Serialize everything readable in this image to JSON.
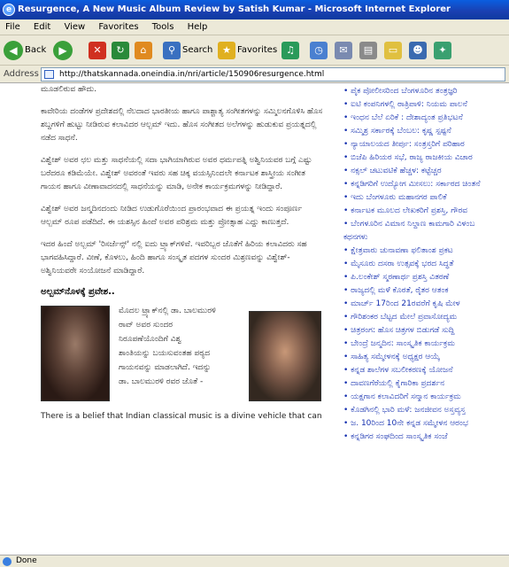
{
  "window": {
    "title": "Resurgence, A New Music Album Review by Satish Kumar - Microsoft Internet Explorer"
  },
  "menu": [
    "File",
    "Edit",
    "View",
    "Favorites",
    "Tools",
    "Help"
  ],
  "toolbar": {
    "back": "Back",
    "search": "Search",
    "favorites": "Favorites"
  },
  "address": {
    "label": "Address",
    "url": "http://thatskannada.oneindia.in/nri/article/150906resurgence.html"
  },
  "article": {
    "paragraphs": [
      "ಮೂಡಲಿರುವ ಹೌದು.",
      "ಕಾವೇರಿಯ ದಂಡೆಗಳ ಪ್ರದೇಶದಲ್ಲಿ ನೆಲದಾದ ಭಾರತೀಯ ಹಾಗೂ ಪಾಶ್ಚಾತ್ಯ ಸಂಗೀತಗಳನ್ನು ಸಮ್ಮಿಲನಗೊಳಿಸಿ ಹೊಸ ಶಬ್ದಗಳಿಗೆ ಹುಟ್ಟು ನೀಡಿರುವ ಕಲಾವಿದರ ಆಲ್ಬಮ್ ಇದು. ಹೊಸ ಸಂಗೀತದ ಅಲೆಗಳನ್ನು ಹುಡುಕುವ ಪ್ರಯತ್ನದಲ್ಲಿ ನಡೆದ ಸಾಧನೆ.",
      "ವಿಶ್ವೇಶ್ ಅವರ ಛಲ ಮತ್ತು ಸಾಧನೆಯಲ್ಲಿ ಸದಾ ಭಾಗಿಯಾಗಿರುವ ಅವರ ಧರ್ಮಪತ್ನಿ ಅಶ್ವಿನಿಯವರ ಬಗ್ಗೆ ಎಷ್ಟು ಬರೆದರೂ ಕಡಿಮೆಯೇ. ವಿಶ್ವೇಶ್ ಅವರಂತೆ ಇವರು ಸಹ ಚಿಕ್ಕ ವಯಸ್ಸಿನಿಂದಲೇ ಕರ್ನಾಟಕ ಶಾಸ್ತ್ರೀಯ ಸಂಗೀತ ಗಾಯನ ಹಾಗೂ ವೀಣಾವಾದನದಲ್ಲಿ ಸಾಧನೆಯನ್ನು ಮಾಡಿ, ಅನೇಕ ಕಾರ್ಯಕ್ರಮಗಳನ್ನು ನೀಡಿದ್ದಾರೆ.",
      "ವಿಶ್ವೇಶ್ ಅವರ ಜನ್ಮದಿನದಂದು ನೀಡಿದ ಉಡುಗೊರೆಯಿಂದ ಪ್ರಾರಂಭವಾದ ಈ ಪ್ರಯತ್ನ ಇಂದು ಸಂಪೂರ್ಣ ಆಲ್ಬಮ್ ರೂಪ ಪಡೆದಿದೆ. ಈ ಯಶಸ್ಸಿನ ಹಿಂದೆ ಅವರ ಪರಿಶ್ರಮ ಮತ್ತು ಪ್ರೋತ್ಸಾಹ ಎದ್ದು ಕಾಣುತ್ತದೆ.",
      "ಇದರ ಹಿಂದೆ ಅಲ್ಬಮ್ 'ರಿಸರ್ಜೆನ್ಸ್' ನಲ್ಲಿ ಐದು ಟ್ರ್ಯಾಕ್‌ಗಳಿವೆ. ಇವರಿಬ್ಬರ ಜೊತೆಗೆ ಹಿರಿಯ ಕಲಾವಿದರು ಸಹ ಭಾಗವಹಿಸಿದ್ದಾರೆ. ವೀಣೆ, ಕೊಳಲು, ಹಿಂದಿ ಹಾಗೂ ಸಂಸ್ಕೃತ ಪದಗಳ ಸುಂದರ ಮಿಶ್ರಣವನ್ನು ವಿಶ್ವೇಶ್-ಅಶ್ವಿನಿಯವರೇ ಸಂಯೋಜನೆ ಮಾಡಿದ್ದಾರೆ."
    ],
    "heading": "ಅಲ್ಬಮ್‌ನೊಳಕ್ಕೆ ಪ್ರವೇಶ..",
    "caption_lines": [
      "ಮೊದಲ ಟ್ರ್ಯಾಕ್‌ನಲ್ಲಿ ಡಾ. ಬಾಲಮುರಳಿ",
      "ರಾವ್ ಅವರ ಸುಂದರ",
      "ನಿರೂಪಣೆಯೊಂದಿಗೆ ವಿಶ್ವ",
      "ಶಾಂತಿಯನ್ನು ಬಯಸುವಂತಹ ಪಠ್ಯದ",
      "ಗಾಯನವನ್ನು ಮಾಡಲಾಗಿದೆ. ಇದನ್ನು",
      "ಡಾ. ಬಾಲಮುರಳಿ ರವರ ಜೊತೆ -"
    ],
    "english_text": "There is a belief that Indian classical music is a divine vehicle that can"
  },
  "sidebar": [
    {
      "text": "ಪೈಕ ಪೋಲೀಸರಿಂದ ಬೆಂಗಳೂರಿನ ತಂತ್ರಜ್ಞರಿ",
      "bullet": true
    },
    {
      "text": "ಐಟಿ ಕಂಪನಿಗಳಲ್ಲಿ ರಾತ್ರಿಪಾಳಿ: ನಿಯಮ ಪಾಲನೆ",
      "bullet": true
    },
    {
      "text": "ಇಂಧನ ಬೆಲೆ ಏರಿಕೆ : ದೇಶಾದ್ಯಂತ ಪ್ರತಿಭಟನೆ",
      "bullet": true
    },
    {
      "text": "ಸಮ್ಮಿಶ್ರ ಸರ್ಕಾರಕ್ಕೆ ಬೆಂಬಲ: ಕೃಷ್ಣ ಸ್ಪಷ್ಟನೆ",
      "bullet": true
    },
    {
      "text": "ನ್ಯಾಯಾಲಯದ ತೀರ್ಪು: ಸಂತ್ರಸ್ತರಿಗೆ ಪರಿಹಾರ",
      "bullet": true
    },
    {
      "text": "ಬಿಜೆಪಿ ಹಿರಿಯರ ಸಭೆ, ರಾಜ್ಯ ರಾಜಕೀಯ ವಿಚಾರ",
      "bullet": true
    },
    {
      "text": "ನಕ್ಸಲ್ ಚಟುವಟಿಕೆ ಹೆಚ್ಚಳ: ಕಟ್ಟೆಚ್ಚರ",
      "bullet": true
    },
    {
      "text": "ಕನ್ನಡಿಗರಿಗೆ ಉದ್ಯೋಗ ಮೀಸಲು: ಸರ್ಕಾರದ ಚಿಂತನೆ",
      "bullet": true
    },
    {
      "text": "ಇದು ಬೆಂಗಳೂರು ಮಹಾನಗರ ಪಾಲಿಕೆ",
      "bullet": true
    },
    {
      "text": "ಕರ್ನಾಟಕ ಮೂಲದ ಲೇಖಕರಿಗೆ ಪ್ರಶಸ್ತಿ, ಗೌರವ",
      "bullet": true
    },
    {
      "text": "ಬೆಂಗಳೂರಿನ ವಿಮಾನ ನಿಲ್ದಾಣ ಕಾಮಗಾರಿ ವಿಳಂಬ",
      "bullet": true
    },
    {
      "text": "ಕಥನಗಳು",
      "bullet": false
    },
    {
      "text": "ಕ್ಷೇತ್ರವಾರು ಚುನಾವಣಾ ಫಲಿತಾಂಶ ಪ್ರಕಟ",
      "bullet": true
    },
    {
      "text": "ಮೈಸೂರು ದಸರಾ ಉತ್ಸವಕ್ಕೆ ಭರದ ಸಿದ್ಧತೆ",
      "bullet": true
    },
    {
      "text": "ಪಿ.ಲಂಕೇಶ್ ಸ್ಮರಣಾರ್ಥ ಪ್ರಶಸ್ತಿ ವಿತರಣೆ",
      "bullet": true
    },
    {
      "text": "ರಾಜ್ಯದಲ್ಲಿ ಮಳೆ ಕೊರತೆ, ರೈತರ ಆತಂಕ",
      "bullet": true
    },
    {
      "text": "ಮಾರ್ಚ್ 17ರಿಂದ 21ರವರೆಗೆ ಕೃಷಿ ಮೇಳ",
      "bullet": true
    },
    {
      "text": "ಗೌರಿಶಂಕರ ಬೆಟ್ಟದ ಮೇಲೆ ಪ್ರವಾಸೋದ್ಯಮ",
      "bullet": true
    },
    {
      "text": "ಚಿತ್ರರಂಗ: ಹೊಸ ಚಿತ್ರಗಳ ಬಿಡುಗಡೆ ಸುದ್ದಿ",
      "bullet": true
    },
    {
      "text": "ಬೇಂದ್ರೆ ಜನ್ಮದಿನ: ಸಾಂಸ್ಕೃತಿಕ ಕಾರ್ಯಕ್ರಮ",
      "bullet": true
    },
    {
      "text": "ಸಾಹಿತ್ಯ ಸಮ್ಮೇಳನಕ್ಕೆ ಅಧ್ಯಕ್ಷರ ಆಯ್ಕೆ",
      "bullet": true
    },
    {
      "text": "ಕನ್ನಡ ಶಾಲೆಗಳ ಸಬಲೀಕರಣಕ್ಕೆ ಯೋಜನೆ",
      "bullet": true
    },
    {
      "text": "ದಾವಣಗೆರೆಯಲ್ಲಿ ಕೈಗಾರಿಕಾ ಪ್ರದರ್ಶನ",
      "bullet": true
    },
    {
      "text": "ಯಕ್ಷಗಾನ ಕಲಾವಿದರಿಗೆ ಸನ್ಮಾನ ಕಾರ್ಯಕ್ರಮ",
      "bullet": true
    },
    {
      "text": "ಕೊಡಗಿನಲ್ಲಿ ಭಾರಿ ಮಳೆ: ಜನಜೀವನ ಅಸ್ತವ್ಯಸ್ತ",
      "bullet": true
    },
    {
      "text": "ಜ. 10ರಿಂದ 10ನೇ ಕನ್ನಡ ಸಮ್ಮೇಳನ ಆರಂಭ",
      "bullet": true
    },
    {
      "text": "ಕನ್ನಡಿಗರ ಸಂಘದಿಂದ ಸಾಂಸ್ಕೃತಿಕ ಸಂಜೆ",
      "bullet": true
    }
  ],
  "status": {
    "text": "Done"
  }
}
